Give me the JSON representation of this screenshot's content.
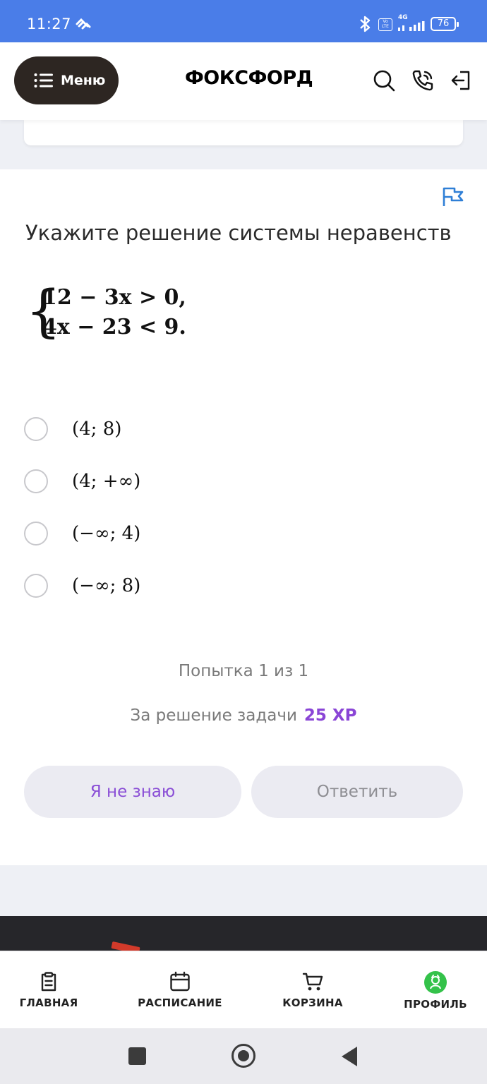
{
  "status_bar": {
    "time": "11:27",
    "volte_label": "Vo LTE",
    "network": "4G",
    "battery": "76"
  },
  "header": {
    "menu_label": "Меню",
    "logo": "ФОКСФОРД"
  },
  "task": {
    "title": "Укажите решение системы неравенств",
    "system": {
      "line1": "12 − 3x > 0,",
      "line2": "4x − 23 < 9."
    },
    "options": [
      {
        "label": "(4; 8)"
      },
      {
        "label": "(4; +∞)"
      },
      {
        "label": "(−∞; 4)"
      },
      {
        "label": "(−∞; 8)"
      }
    ],
    "attempt": "Попытка 1 из 1",
    "reward_text": "За решение задачи",
    "reward_xp": "25 XP",
    "dont_know_label": "Я не знаю",
    "answer_label": "Ответить"
  },
  "bottom_nav": {
    "items": [
      {
        "label": "ГЛАВНАЯ",
        "icon": "clipboard-icon"
      },
      {
        "label": "РАСПИСАНИЕ",
        "icon": "calendar-icon"
      },
      {
        "label": "КОРЗИНА",
        "icon": "cart-icon"
      },
      {
        "label": "ПРОФИЛЬ",
        "icon": "profile-avatar-icon"
      }
    ]
  },
  "colors": {
    "status_bar": "#4a7de8",
    "accent_purple": "#8a45d6",
    "menu_button": "#2d2622",
    "profile_green": "#34c24a",
    "flag_blue": "#2f7fd6"
  }
}
